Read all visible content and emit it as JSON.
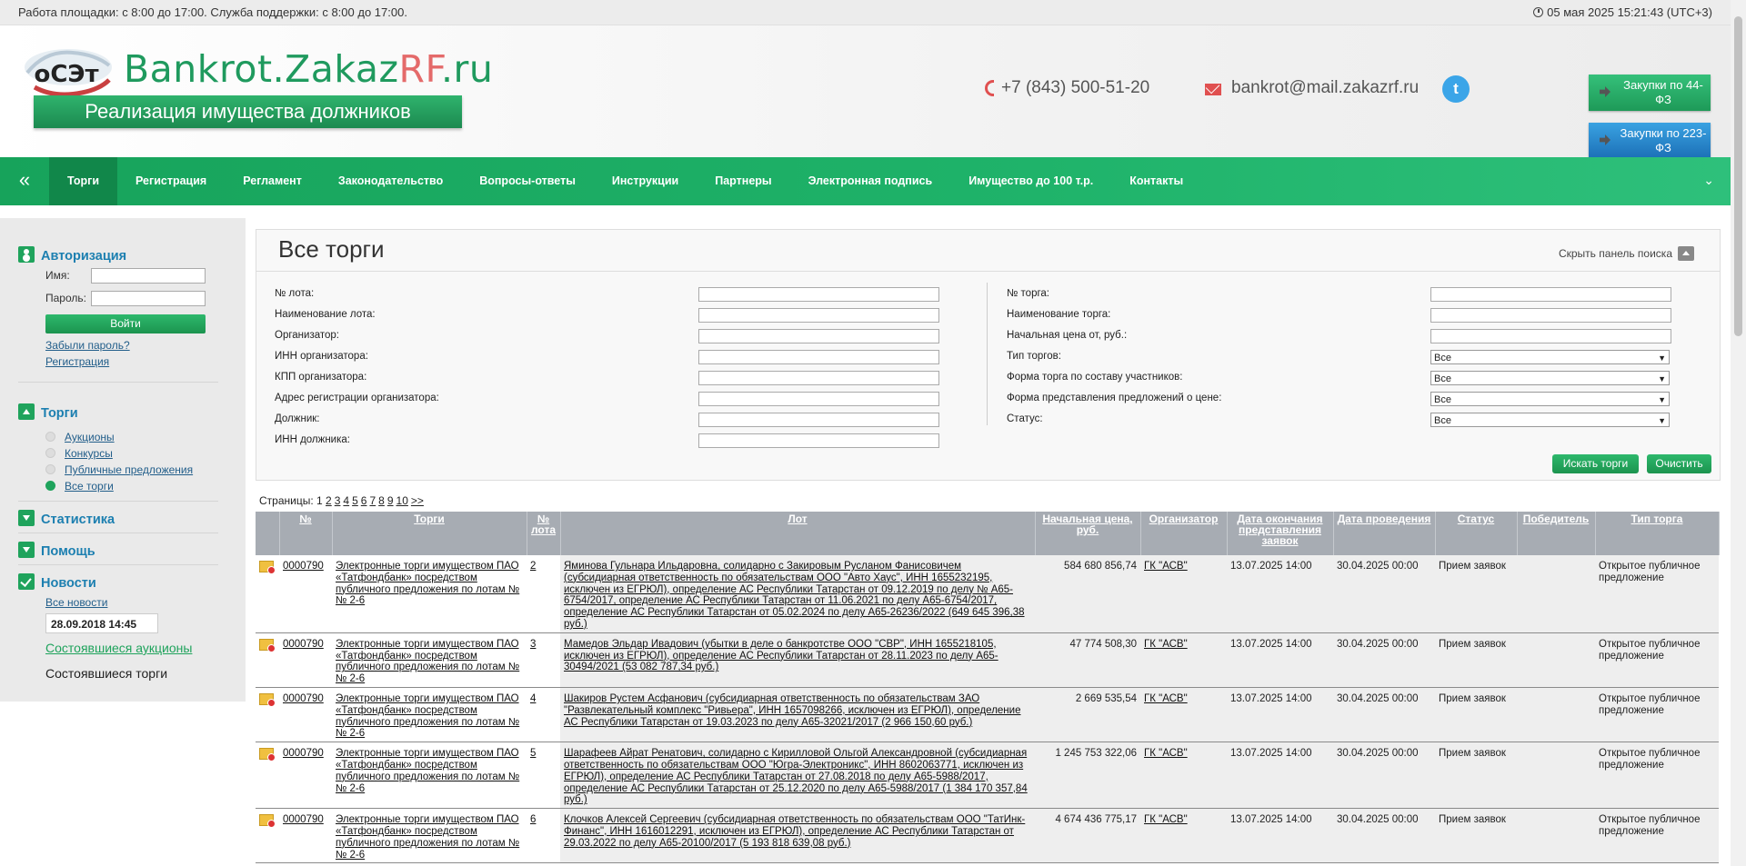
{
  "topbar": {
    "hours": "Работа площадки: с 8:00 до 17:00. Служба поддержки: с 8:00 до 17:00.",
    "datetime": "05 мая 2025 15:21:43 (UTC+3)"
  },
  "header": {
    "logo_mark_text": "оСЭт",
    "logo_main": "Bankrot.Zakaz",
    "logo_rf": "RF",
    "logo_tld": ".ru",
    "tagline": "Реализация имущества должников",
    "phone": "+7 (843) 500-51-20",
    "email": "bankrot@mail.zakazrf.ru",
    "twitter_glyph": "t",
    "btn_44": "Закупки по 44-ФЗ",
    "btn_223": "Закупки по 223-ФЗ"
  },
  "nav": {
    "collapse_glyph": "«",
    "expand_glyph": "⌄",
    "items": [
      "Торги",
      "Регистрация",
      "Регламент",
      "Законодательство",
      "Вопросы-ответы",
      "Инструкции",
      "Партнеры",
      "Электронная подпись",
      "Имущество до 100 т.р.",
      "Контакты"
    ]
  },
  "sidebar": {
    "auth_title": "Авторизация",
    "name_label": "Имя:",
    "password_label": "Пароль:",
    "login_button": "Войти",
    "forgot_link": "Забыли пароль?",
    "register_link": "Регистрация",
    "trades_title": "Торги",
    "trade_items": [
      "Аукционы",
      "Конкурсы",
      "Публичные предложения",
      "Все торги"
    ],
    "stats_title": "Статистика",
    "help_title": "Помощь",
    "news_title": "Новости",
    "all_news": "Все новости",
    "news_date": "28.09.2018 14:45",
    "news_link": "Состоявшиеся аукционы",
    "news_text": "Состоявшиеся торги"
  },
  "panel": {
    "title": "Все торги",
    "hide_label": "Скрыть панель поиска",
    "left_labels": [
      "№ лота:",
      "Наименование лота:",
      "Организатор:",
      "ИНН организатора:",
      "КПП организатора:",
      "Адрес регистрации организатора:",
      "Должник:",
      "ИНН должника:"
    ],
    "right_labels": [
      "№ торга:",
      "Наименование торга:",
      "Начальная цена от, руб.:",
      "Тип торгов:",
      "Форма торга по составу участников:",
      "Форма представления предложений о цене:",
      "Статус:"
    ],
    "select_value": "Все",
    "search_button": "Искать торги",
    "clear_button": "Очистить"
  },
  "pages": {
    "label": "Страницы:",
    "current": "1",
    "links": [
      "2",
      "3",
      "4",
      "5",
      "6",
      "7",
      "8",
      "9",
      "10",
      ">>"
    ]
  },
  "table": {
    "headers": [
      "№",
      "Торги",
      "№ лота",
      "Лот",
      "Начальная цена, руб.",
      "Организатор",
      "Дата окончания представления заявок",
      "Дата проведения",
      "Статус",
      "Победитель",
      "Тип торга"
    ],
    "rows": [
      {
        "num": "0000790",
        "trade": "Электронные торги имуществом ПАО «Татфондбанк» посредством публичного предложения по лотам №№ 2-6",
        "lot_no": "2",
        "lot": "Яминова Гульнара Ильдаровна, солидарно с Закировым Русланом Фанисовичем (субсидиарная ответственность по обязательствам ООО \"Авто Хаус\", ИНН 1655232195, исключен из ЕГРЮЛ), определение АС Республики Татарстан от 09.12.2019 по делу № А65-6754/2017, определение АС Республики Татарстан от 11.06.2021 по делу А65-6754/2017, определение АС Республики Татарстан от 05.02.2024 по делу А65-26236/2022 (649 645 396,38 руб.)",
        "price": "584 680 856,74",
        "org": "ГК \"АСВ\"",
        "end": "13.07.2025 14:00",
        "date": "30.04.2025 00:00",
        "status": "Прием заявок",
        "winner": "",
        "type": "Открытое публичное предложение"
      },
      {
        "num": "0000790",
        "trade": "Электронные торги имуществом ПАО «Татфондбанк» посредством публичного предложения по лотам №№ 2-6",
        "lot_no": "3",
        "lot": "Мамедов Эльдар Ивадович (убытки в деле о банкротстве ООО \"СВР\", ИНН 1655218105, исключен из ЕГРЮЛ), определение АС Республики Татарстан от 28.11.2023 по делу А65-30494/2021 (53 082 787,34 руб.)",
        "price": "47 774 508,30",
        "org": "ГК \"АСВ\"",
        "end": "13.07.2025 14:00",
        "date": "30.04.2025 00:00",
        "status": "Прием заявок",
        "winner": "",
        "type": "Открытое публичное предложение"
      },
      {
        "num": "0000790",
        "trade": "Электронные торги имуществом ПАО «Татфондбанк» посредством публичного предложения по лотам №№ 2-6",
        "lot_no": "4",
        "lot": "Шакиров Рустем Асфанович (субсидиарная ответственность по обязательствам ЗАО \"Развлекательный комплекс \"Ривьера\", ИНН 1657098266, исключен из ЕГРЮЛ), определение АС Республики Татарстан от 19.03.2023 по делу А65-32021/2017 (2 966 150,60 руб.)",
        "price": "2 669 535,54",
        "org": "ГК \"АСВ\"",
        "end": "13.07.2025 14:00",
        "date": "30.04.2025 00:00",
        "status": "Прием заявок",
        "winner": "",
        "type": "Открытое публичное предложение"
      },
      {
        "num": "0000790",
        "trade": "Электронные торги имуществом ПАО «Татфондбанк» посредством публичного предложения по лотам №№ 2-6",
        "lot_no": "5",
        "lot": "Шарафеев Айрат Ренатович, солидарно с Кирилловой Ольгой Александровной (субсидиарная ответственность по обязательствам ООО \"Югра-Электроникс\", ИНН 8602063771, исключен из ЕГРЮЛ), определение АС Республики Татарстан от 27.08.2018 по делу А65-5988/2017, определение АС Республики Татарстан от 25.12.2020 по делу А65-5988/2017 (1 384 170 357,84 руб.)",
        "price": "1 245 753 322,06",
        "org": "ГК \"АСВ\"",
        "end": "13.07.2025 14:00",
        "date": "30.04.2025 00:00",
        "status": "Прием заявок",
        "winner": "",
        "type": "Открытое публичное предложение"
      },
      {
        "num": "0000790",
        "trade": "Электронные торги имуществом ПАО «Татфондбанк» посредством публичного предложения по лотам №№ 2-6",
        "lot_no": "6",
        "lot": "Клочков Алексей Сергеевич (субсидиарная ответственность по обязательствам ООО \"ТатИнк-Финанс\", ИНН 1616012291, исключен из ЕГРЮЛ), определение АС Республики Татарстан от 29.03.2022 по делу А65-20100/2017 (5 193 818 639,08 руб.)",
        "price": "4 674 436 775,17",
        "org": "ГК \"АСВ\"",
        "end": "13.07.2025 14:00",
        "date": "30.04.2025 00:00",
        "status": "Прием заявок",
        "winner": "",
        "type": "Открытое публичное предложение"
      }
    ]
  }
}
